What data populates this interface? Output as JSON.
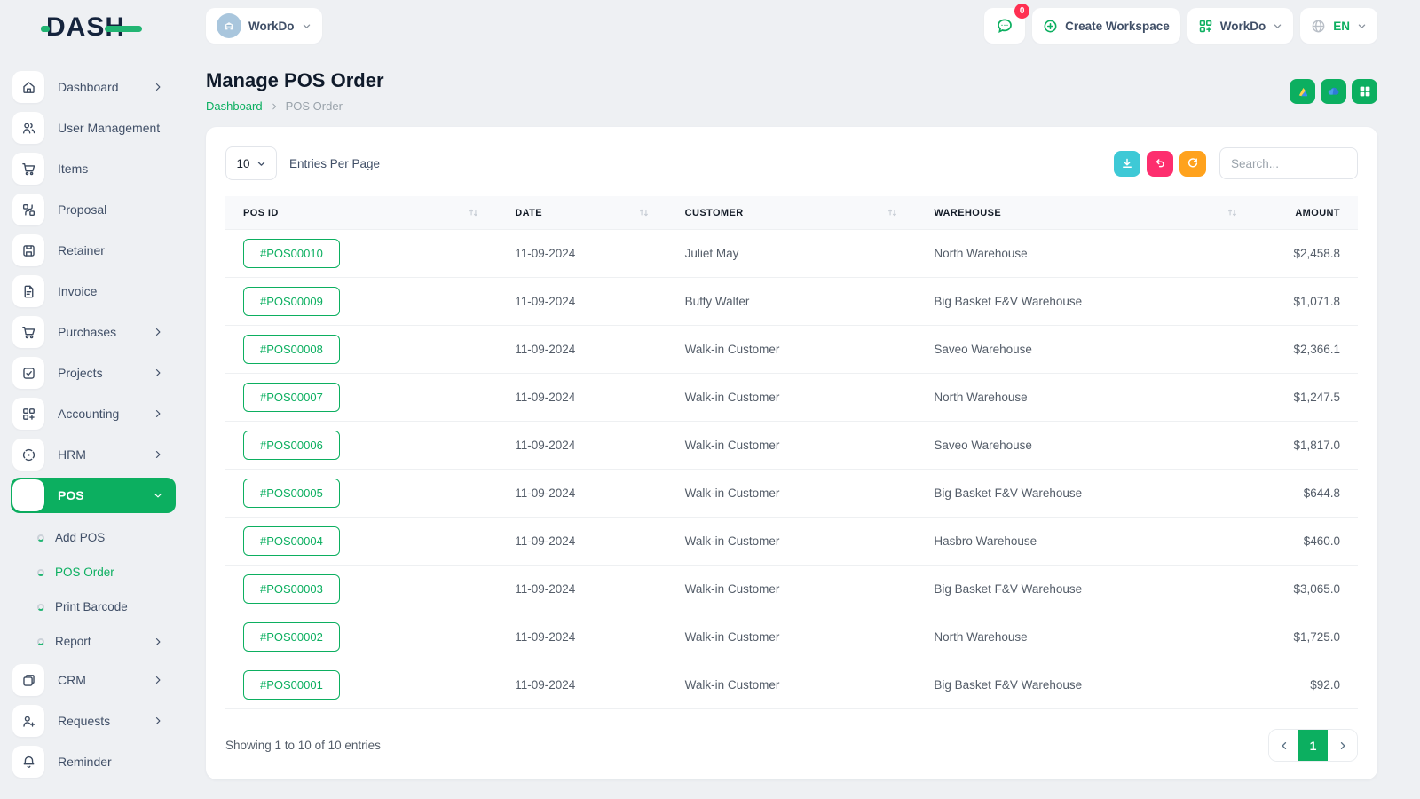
{
  "brand": {
    "logo_text": "DASH"
  },
  "topbar": {
    "workspace_label": "WorkDo",
    "chat_badge": "0",
    "create_workspace_label": "Create Workspace",
    "apps_label": "WorkDo",
    "language": "EN"
  },
  "sidebar": {
    "items": [
      {
        "label": "Dashboard"
      },
      {
        "label": "User Management"
      },
      {
        "label": "Items"
      },
      {
        "label": "Proposal"
      },
      {
        "label": "Retainer"
      },
      {
        "label": "Invoice"
      },
      {
        "label": "Purchases"
      },
      {
        "label": "Projects"
      },
      {
        "label": "Accounting"
      },
      {
        "label": "HRM"
      },
      {
        "label": "POS"
      },
      {
        "label": "CRM"
      },
      {
        "label": "Requests"
      },
      {
        "label": "Reminder"
      }
    ],
    "pos_submenu": [
      {
        "label": "Add POS"
      },
      {
        "label": "POS Order"
      },
      {
        "label": "Print Barcode"
      },
      {
        "label": "Report"
      }
    ]
  },
  "page": {
    "title": "Manage POS Order",
    "breadcrumb_home": "Dashboard",
    "breadcrumb_current": "POS Order"
  },
  "controls": {
    "entries_value": "10",
    "entries_label": "Entries Per Page",
    "search_placeholder": "Search..."
  },
  "table": {
    "headers": [
      "POS ID",
      "DATE",
      "CUSTOMER",
      "WAREHOUSE",
      "AMOUNT"
    ],
    "rows": [
      {
        "pos_id": "#POS00010",
        "date": "11-09-2024",
        "customer": "Juliet May",
        "warehouse": "North Warehouse",
        "amount": "$2,458.8"
      },
      {
        "pos_id": "#POS00009",
        "date": "11-09-2024",
        "customer": "Buffy Walter",
        "warehouse": "Big Basket F&V Warehouse",
        "amount": "$1,071.8"
      },
      {
        "pos_id": "#POS00008",
        "date": "11-09-2024",
        "customer": "Walk-in Customer",
        "warehouse": "Saveo Warehouse",
        "amount": "$2,366.1"
      },
      {
        "pos_id": "#POS00007",
        "date": "11-09-2024",
        "customer": "Walk-in Customer",
        "warehouse": "North Warehouse",
        "amount": "$1,247.5"
      },
      {
        "pos_id": "#POS00006",
        "date": "11-09-2024",
        "customer": "Walk-in Customer",
        "warehouse": "Saveo Warehouse",
        "amount": "$1,817.0"
      },
      {
        "pos_id": "#POS00005",
        "date": "11-09-2024",
        "customer": "Walk-in Customer",
        "warehouse": "Big Basket F&V Warehouse",
        "amount": "$644.8"
      },
      {
        "pos_id": "#POS00004",
        "date": "11-09-2024",
        "customer": "Walk-in Customer",
        "warehouse": "Hasbro Warehouse",
        "amount": "$460.0"
      },
      {
        "pos_id": "#POS00003",
        "date": "11-09-2024",
        "customer": "Walk-in Customer",
        "warehouse": "Big Basket F&V Warehouse",
        "amount": "$3,065.0"
      },
      {
        "pos_id": "#POS00002",
        "date": "11-09-2024",
        "customer": "Walk-in Customer",
        "warehouse": "North Warehouse",
        "amount": "$1,725.0"
      },
      {
        "pos_id": "#POS00001",
        "date": "11-09-2024",
        "customer": "Walk-in Customer",
        "warehouse": "Big Basket F&V Warehouse",
        "amount": "$92.0"
      }
    ],
    "footer_text": "Showing 1 to 10 of 10 entries",
    "pagination_page": "1"
  },
  "colors": {
    "primary_green": "#0caf60",
    "teal": "#3ec9d6",
    "pink": "#fd2e6e",
    "orange": "#ffa21d",
    "badge_red": "#ff3052"
  }
}
